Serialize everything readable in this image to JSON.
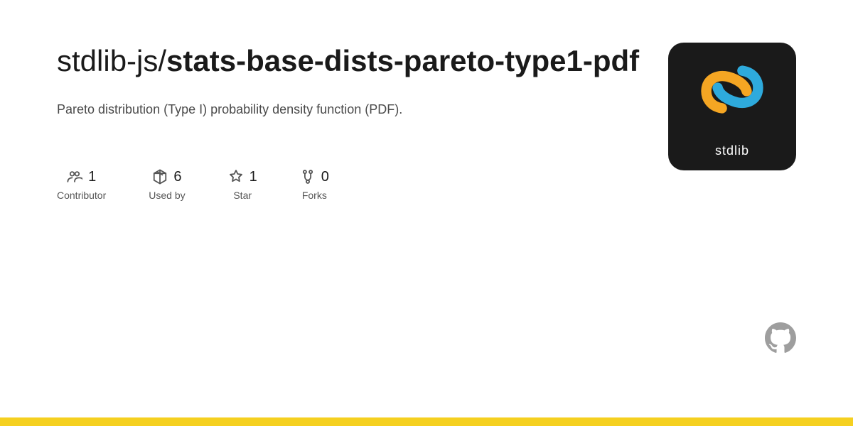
{
  "header": {
    "owner": "stdlib-js/",
    "repo_name": "stats-base-\ndists-pareto-type1-pdf",
    "repo_name_bold": "stats-base-dists-pareto-type1-pdf",
    "description": "Pareto distribution (Type I) probability density function (PDF)."
  },
  "stats": [
    {
      "id": "contributors",
      "icon": "contributor-icon",
      "count": "1",
      "label": "Contributor"
    },
    {
      "id": "used-by",
      "icon": "package-icon",
      "count": "6",
      "label": "Used by"
    },
    {
      "id": "stars",
      "icon": "star-icon",
      "count": "1",
      "label": "Star"
    },
    {
      "id": "forks",
      "icon": "fork-icon",
      "count": "0",
      "label": "Forks"
    }
  ],
  "stdlib": {
    "alt": "stdlib logo",
    "brand_text": "stdlib"
  },
  "bottom_bar_color": "#f5d020"
}
